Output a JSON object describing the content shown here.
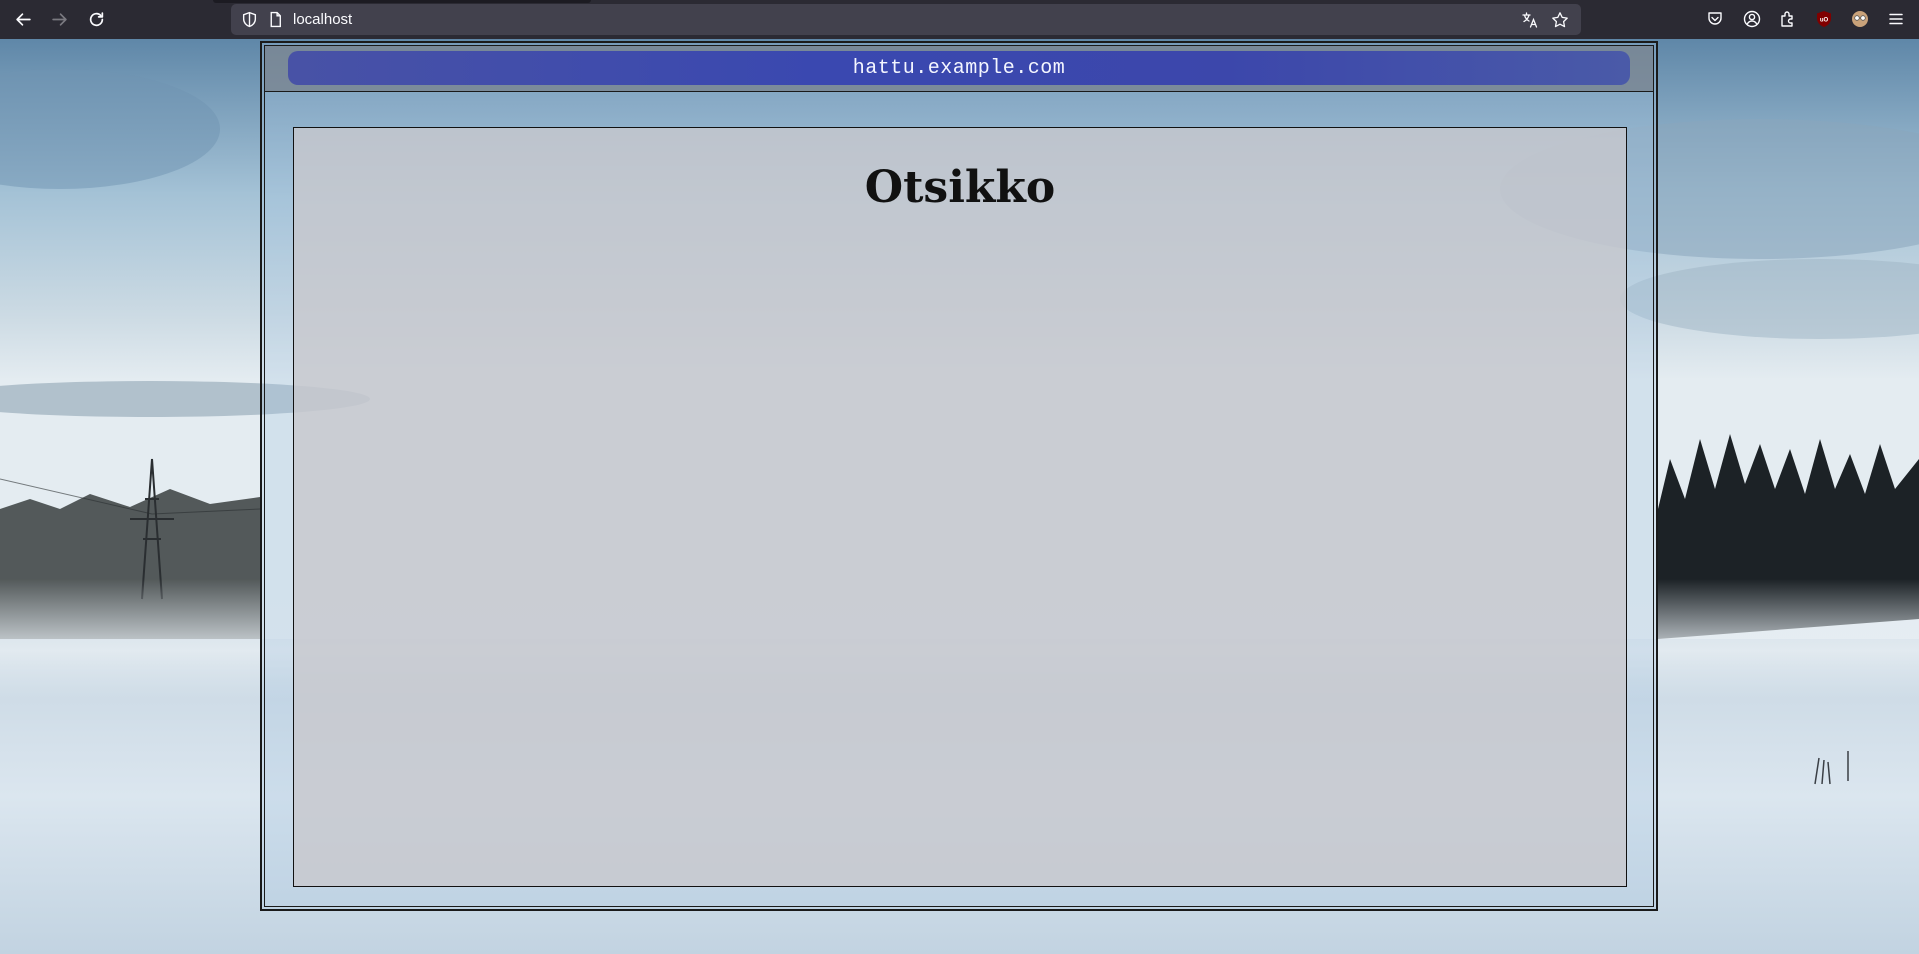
{
  "browser": {
    "url": "localhost",
    "toolbar_icons": [
      "pocket-icon",
      "account-icon",
      "extensions-icon",
      "ublock-icon",
      "profile-avatar-icon",
      "menu-icon"
    ]
  },
  "page": {
    "site_name": "hattu.example.com",
    "heading": "Otsikko"
  },
  "colors": {
    "chrome_bg": "#2b2a33",
    "urlbar_bg": "#42414d",
    "header_pill": "#3a48b0",
    "content_bg": "#c8c8cd"
  }
}
